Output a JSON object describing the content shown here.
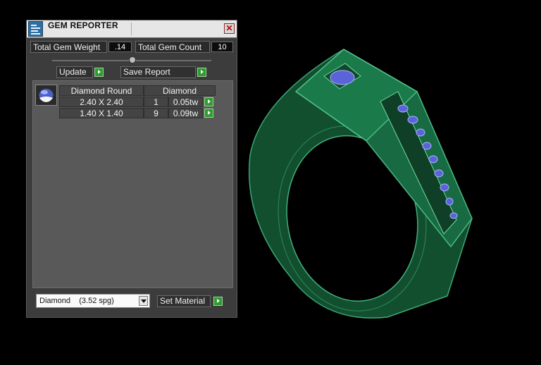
{
  "window": {
    "title": "GEM REPORTER",
    "close_label": "✕"
  },
  "stats": {
    "total_gem_weight_label": "Total Gem Weight",
    "total_gem_weight_value": ".14",
    "total_gem_count_label": "Total Gem Count",
    "total_gem_count_value": "10"
  },
  "actions": {
    "update_label": "Update",
    "save_report_label": "Save Report"
  },
  "table": {
    "header_shape": "Diamond Round",
    "header_material": "Diamond",
    "rows": [
      {
        "size": "2.40 X 2.40",
        "count": "1",
        "weight": "0.05tw"
      },
      {
        "size": "1.40 X 1.40",
        "count": "9",
        "weight": "0.09tw"
      }
    ]
  },
  "material": {
    "selected": "Diamond    (3.52 spg)",
    "set_material_label": "Set Material"
  },
  "colors": {
    "ring_green": "#1d7a4a",
    "gem_blue": "#5b63d8",
    "go_green": "#2f9a2f"
  },
  "icons": [
    "app-icon",
    "close-icon",
    "slider-knob",
    "play-arrow-icon",
    "diamond-thumbnail-icon",
    "chevron-down-icon"
  ]
}
